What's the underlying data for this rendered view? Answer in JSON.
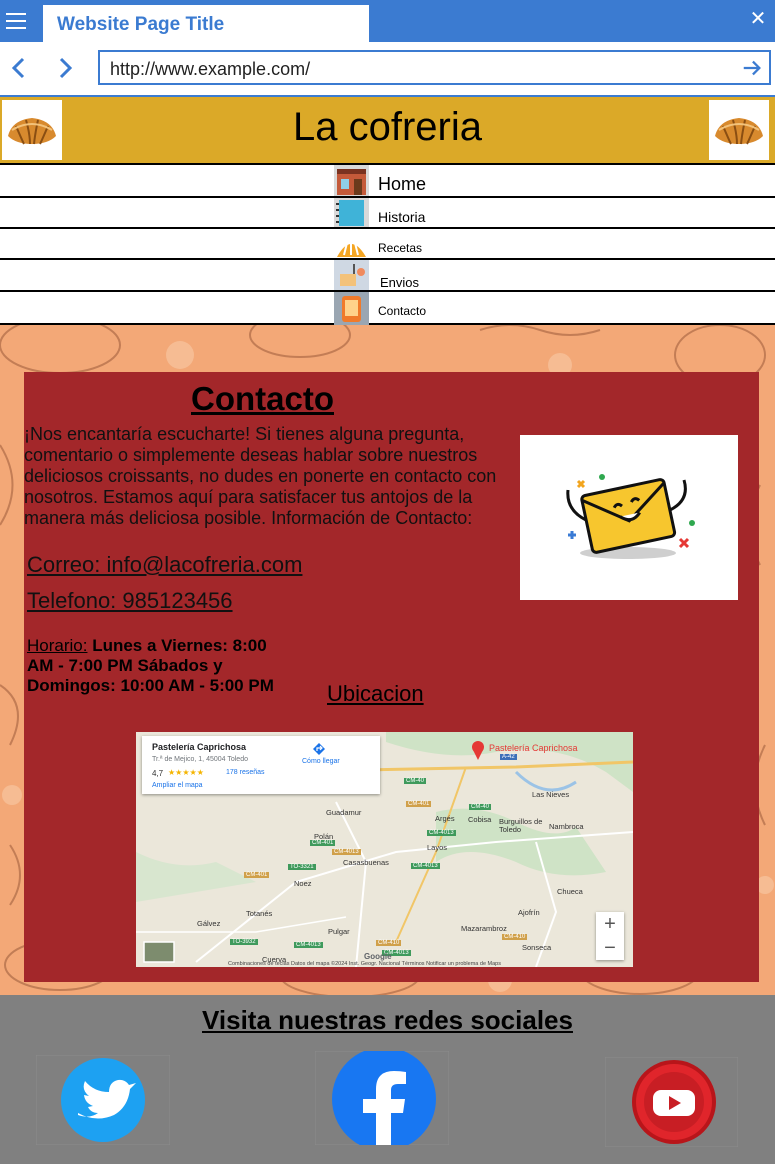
{
  "browser": {
    "tab_title": "Website Page Title",
    "url": "http://www.example.com/"
  },
  "site": {
    "title": "La cofreria"
  },
  "nav": {
    "items": [
      {
        "label": "Home"
      },
      {
        "label": "Historia"
      },
      {
        "label": "Recetas"
      },
      {
        "label": "Envios"
      },
      {
        "label": "Contacto"
      }
    ]
  },
  "contact": {
    "heading": "Contacto",
    "intro": "¡Nos encantaría escucharte! Si tienes alguna pregunta, comentario o simplemente deseas hablar sobre nuestros deliciosos croissants, no dudes en ponerte en contacto con nosotros. Estamos aquí para satisfacer tus antojos de la manera más deliciosa posible. Información de Contacto:",
    "email": "Correo: info@lacofreria.com ",
    "phone": "Telefono: 985123456",
    "hours_label": "Horario:",
    "hours_value": " Lunes a Viernes: 8:00 AM - 7:00 PM Sábados y Domingos: 10:00 AM - 5:00 PM",
    "location_heading": "Ubicacion"
  },
  "map": {
    "place_name": "Pastelería Caprichosa",
    "address": "Tr.ª de Mejico, 1, 45004 Toledo",
    "rating": "4,7",
    "stars": "★★★★★",
    "reviews": "178 reseñas",
    "directions": "Cómo llegar",
    "enlarge": "Ampliar el mapa",
    "pin_label": "Pastelería Caprichosa",
    "towns": [
      "Las Nieves",
      "Guadamur",
      "Argés",
      "Cobisa",
      "Burguillos de Toledo",
      "Nambroca",
      "Polán",
      "Layos",
      "Casasbuenas",
      "Noez",
      "Chueca",
      "Totanés",
      "Ajofrín",
      "Gálvez",
      "Pulgar",
      "Mazarambroz",
      "Sonseca",
      "Cuerva"
    ],
    "roads": [
      "A-42",
      "CM-40",
      "CM-401",
      "CM-40",
      "CM-4013",
      "CM-401",
      "CM-4013",
      "TO-3321",
      "CM-4013",
      "CM-401",
      "TO-3932",
      "CM-4013",
      "CM-410",
      "CM-410",
      "CM-4013"
    ],
    "footer": "Combinaciones de teclas   Datos del mapa ©2024 Inst. Geogr. Nacional   Términos   Notificar un problema de Maps",
    "brand": "Google",
    "zoom_in": "+",
    "zoom_out": "−"
  },
  "footer": {
    "social_heading": "Visita nuestras redes sociales"
  },
  "colors": {
    "chrome_blue": "#3b7bd1",
    "header_gold": "#dba928",
    "panel_red": "#a3272a",
    "footer_gray": "#808080",
    "twitter": "#1da1f2",
    "facebook": "#1877f2",
    "youtube": "#e0252b"
  }
}
